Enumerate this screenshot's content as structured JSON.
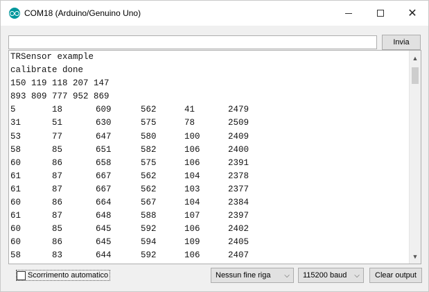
{
  "window": {
    "title": "COM18 (Arduino/Genuino Uno)",
    "icon": "arduino-logo-icon",
    "controls": {
      "minimize": "minimize-icon",
      "maximize": "maximize-icon",
      "close": "close-icon",
      "close_glyph": "✕"
    }
  },
  "send": {
    "input_value": "",
    "input_placeholder": "",
    "button_label": "Invia"
  },
  "output": {
    "lines": [
      [
        "TRSensor example"
      ],
      [
        "calibrate done"
      ],
      [
        "150 119 118 207 147"
      ],
      [
        "893 809 777 952 869"
      ],
      [
        "5",
        "18",
        "609",
        "562",
        "41",
        "2479"
      ],
      [
        "31",
        "51",
        "630",
        "575",
        "78",
        "2509"
      ],
      [
        "53",
        "77",
        "647",
        "580",
        "100",
        "2409"
      ],
      [
        "58",
        "85",
        "651",
        "582",
        "106",
        "2400"
      ],
      [
        "60",
        "86",
        "658",
        "575",
        "106",
        "2391"
      ],
      [
        "61",
        "87",
        "667",
        "562",
        "104",
        "2378"
      ],
      [
        "61",
        "87",
        "667",
        "562",
        "103",
        "2377"
      ],
      [
        "60",
        "86",
        "664",
        "567",
        "104",
        "2384"
      ],
      [
        "61",
        "87",
        "648",
        "588",
        "107",
        "2397"
      ],
      [
        "60",
        "85",
        "645",
        "592",
        "106",
        "2402"
      ],
      [
        "60",
        "86",
        "645",
        "594",
        "109",
        "2405"
      ],
      [
        "58",
        "83",
        "644",
        "592",
        "106",
        "2407"
      ]
    ]
  },
  "bottom": {
    "autoscroll_label": "Scorrimento automatico",
    "autoscroll_checked": false,
    "line_ending_value": "Nessun fine riga",
    "baud_value": "115200 baud",
    "clear_label": "Clear output",
    "chevron_glyph": "⌵"
  },
  "colors": {
    "accent": "#00979c",
    "window_bg": "#f0f0f0",
    "button_bg": "#e1e1e1"
  }
}
